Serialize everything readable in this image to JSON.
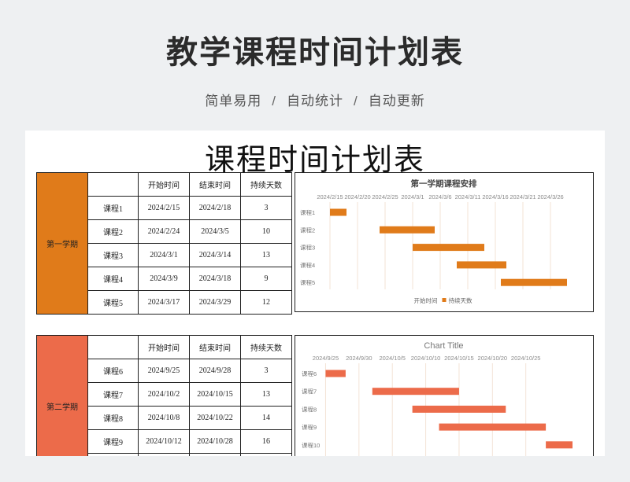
{
  "header": {
    "title": "教学课程时间计划表",
    "features": [
      "简单易用",
      "自动统计",
      "自动更新"
    ],
    "separator": "/"
  },
  "sheet": {
    "title": "课程时间计划表",
    "columns": [
      "",
      "开始时间",
      "结束时间",
      "持续天数"
    ],
    "semesters": [
      {
        "label": "第一学期",
        "color": "#e07b1a",
        "rows": [
          {
            "course": "课程1",
            "start": "2024/2/15",
            "end": "2024/2/18",
            "days": "3"
          },
          {
            "course": "课程2",
            "start": "2024/2/24",
            "end": "2024/3/5",
            "days": "10"
          },
          {
            "course": "课程3",
            "start": "2024/3/1",
            "end": "2024/3/14",
            "days": "13"
          },
          {
            "course": "课程4",
            "start": "2024/3/9",
            "end": "2024/3/18",
            "days": "9"
          },
          {
            "course": "课程5",
            "start": "2024/3/17",
            "end": "2024/3/29",
            "days": "12"
          }
        ]
      },
      {
        "label": "第二学期",
        "color": "#ec6b4a",
        "rows": [
          {
            "course": "课程6",
            "start": "2024/9/25",
            "end": "2024/9/28",
            "days": "3"
          },
          {
            "course": "课程7",
            "start": "2024/10/2",
            "end": "2024/10/15",
            "days": "13"
          },
          {
            "course": "课程8",
            "start": "2024/10/8",
            "end": "2024/10/22",
            "days": "14"
          },
          {
            "course": "课程9",
            "start": "2024/10/12",
            "end": "2024/10/28",
            "days": "16"
          }
        ]
      }
    ]
  },
  "chart_data": [
    {
      "type": "bar",
      "orientation": "horizontal-gantt",
      "title": "第一学期课程安排",
      "categories": [
        "课程1",
        "课程2",
        "课程3",
        "课程4",
        "课程5"
      ],
      "series": [
        {
          "name": "开始时间",
          "values": [
            "2024-02-15",
            "2024-02-24",
            "2024-03-01",
            "2024-03-09",
            "2024-03-17"
          ],
          "visible": false
        },
        {
          "name": "持续天数",
          "values": [
            3,
            10,
            13,
            9,
            12
          ],
          "color": "#e07b1a"
        }
      ],
      "xticks": [
        "2024/2/15",
        "2024/2/20",
        "2024/2/25",
        "2024/3/1",
        "2024/3/6",
        "2024/3/11",
        "2024/3/16",
        "2024/3/21",
        "2024/3/26"
      ],
      "xlim": [
        "2024-02-13",
        "2024-03-30"
      ],
      "legend": "bottom",
      "grid": true
    },
    {
      "type": "bar",
      "orientation": "horizontal-gantt",
      "title": "Chart Title",
      "categories": [
        "课程6",
        "课程7",
        "课程8",
        "课程9",
        "课程10"
      ],
      "series": [
        {
          "name": "开始时间",
          "values": [
            "2024-09-25",
            "2024-10-02",
            "2024-10-08",
            "2024-10-12",
            "2024-10-28"
          ],
          "visible": false
        },
        {
          "name": "持续天数",
          "values": [
            3,
            13,
            14,
            16,
            4
          ],
          "color": "#ec6b4a"
        }
      ],
      "xticks": [
        "2024/9/25",
        "2024/9/30",
        "2024/10/5",
        "2024/10/10",
        "2024/10/15",
        "2024/10/20",
        "2024/10/25"
      ],
      "xlim": [
        "2024-09-24",
        "2024-11-01"
      ],
      "grid": true
    }
  ]
}
